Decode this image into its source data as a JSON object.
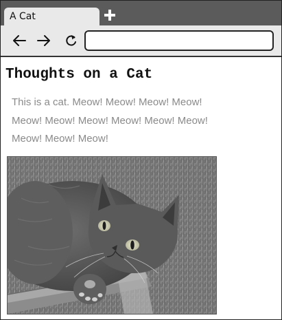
{
  "tab": {
    "title": "A Cat"
  },
  "toolbar": {
    "address_value": "",
    "icons": [
      "back-arrow-icon",
      "forward-arrow-icon",
      "reload-icon",
      "plus-icon"
    ]
  },
  "page": {
    "title": "Thoughts on a Cat",
    "paragraph": "This is a cat. Meow! Meow! Meow! Meow! Meow! Meow! Meow! Meow! Meow! Meow! Meow! Meow! Meow!"
  },
  "colors": {
    "tabstrip": "#5b5b5b",
    "toolbar": "#e9e9e9",
    "paragraph_text": "#8a8a8a"
  }
}
